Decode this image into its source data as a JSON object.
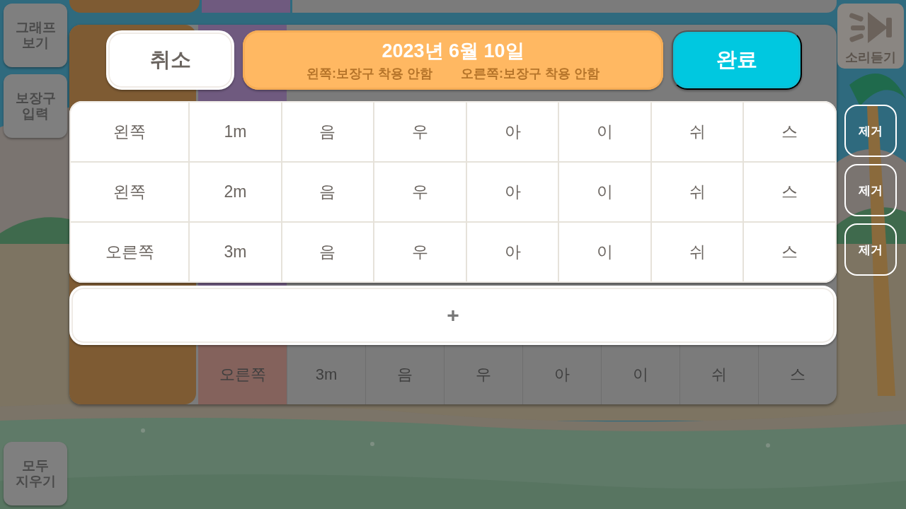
{
  "background": {
    "side_buttons": [
      {
        "label": "그래프 보기"
      },
      {
        "label": "보장구 입력"
      },
      {
        "label": "모두 지우기"
      }
    ],
    "sound_button": {
      "label": "소리듣기"
    },
    "last_row": {
      "cells": [
        "오른쪽",
        "3m",
        "음",
        "우",
        "아",
        "이",
        "쉬",
        "스"
      ]
    }
  },
  "modal": {
    "cancel_button": "취소",
    "header": {
      "date": "2023년 6월 10일",
      "left_status": "왼쪽:보장구 착용 안함",
      "right_status": "오른쪽:보장구 착용 안함"
    },
    "done_button": "완료",
    "rows": [
      {
        "cells": [
          "왼쪽",
          "1m",
          "음",
          "우",
          "아",
          "이",
          "쉬",
          "스"
        ],
        "remove_button": "제거"
      },
      {
        "cells": [
          "왼쪽",
          "2m",
          "음",
          "우",
          "아",
          "이",
          "쉬",
          "스"
        ],
        "remove_button": "제거"
      },
      {
        "cells": [
          "오른쪽",
          "3m",
          "음",
          "우",
          "아",
          "이",
          "쉬",
          "스"
        ],
        "remove_button": "제거"
      }
    ],
    "add_button": "+"
  }
}
